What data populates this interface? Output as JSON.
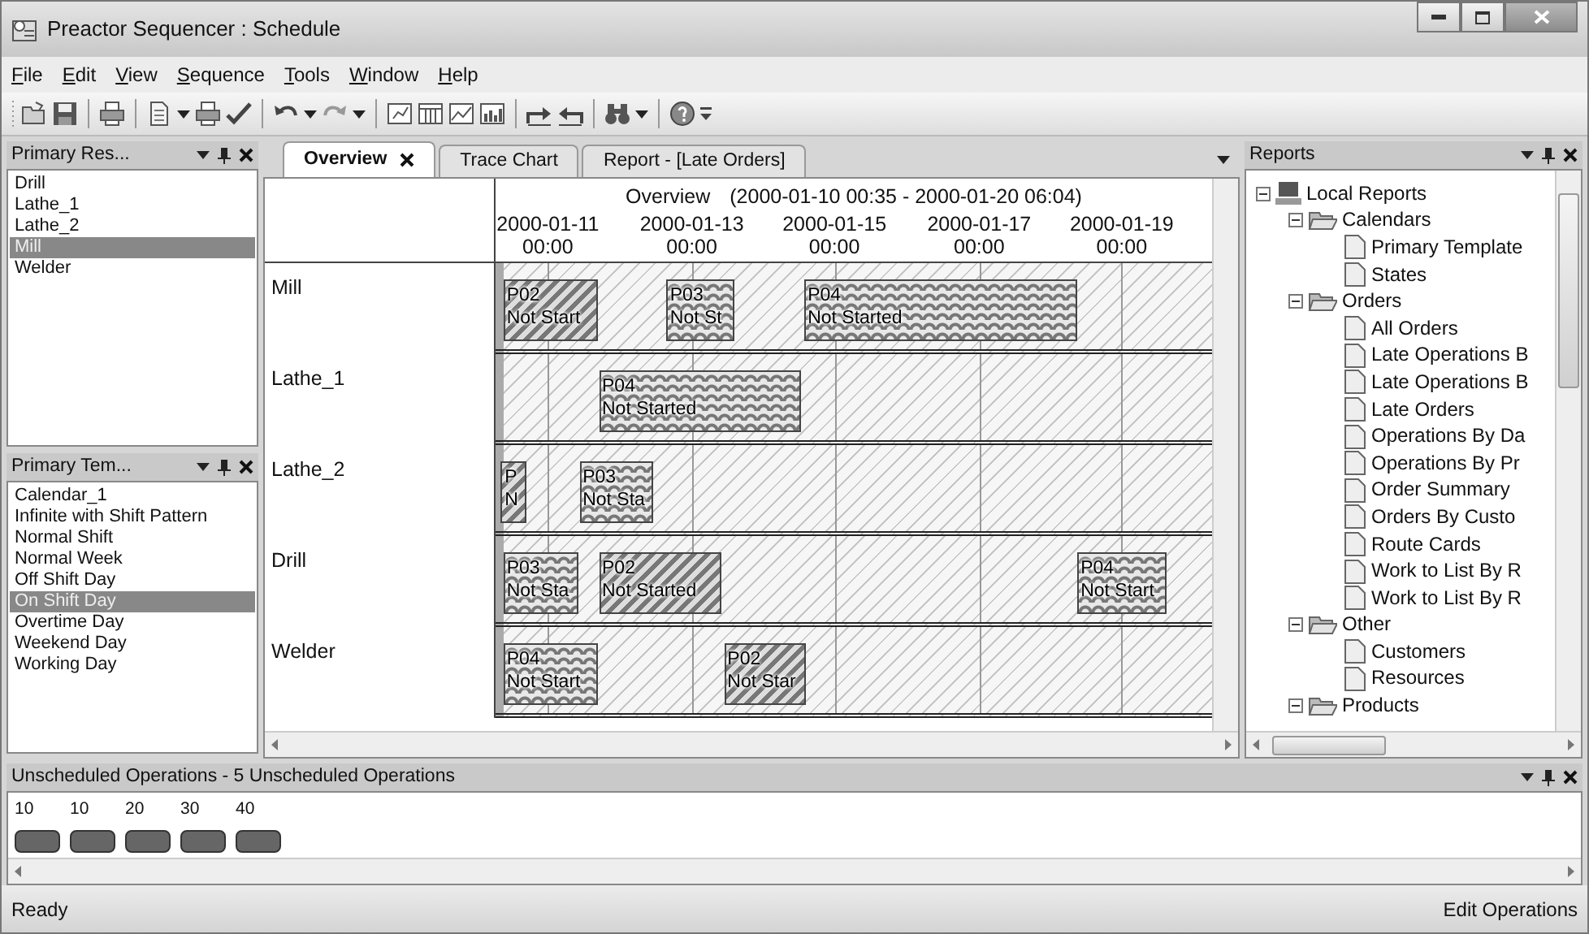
{
  "window": {
    "title": "Preactor Sequencer : Schedule"
  },
  "menu": [
    "File",
    "Edit",
    "View",
    "Sequence",
    "Tools",
    "Window",
    "Help"
  ],
  "left_panels": [
    {
      "title": "Primary Res...",
      "items": [
        {
          "label": "Drill",
          "selected": false
        },
        {
          "label": "Lathe_1",
          "selected": false
        },
        {
          "label": "Lathe_2",
          "selected": false
        },
        {
          "label": "Mill",
          "selected": true
        },
        {
          "label": "Welder",
          "selected": false
        }
      ]
    },
    {
      "title": "Primary Tem...",
      "items": [
        {
          "label": "Calendar_1",
          "selected": false
        },
        {
          "label": "Infinite with Shift Pattern",
          "selected": false
        },
        {
          "label": "Normal Shift",
          "selected": false
        },
        {
          "label": "Normal Week",
          "selected": false
        },
        {
          "label": "Off Shift Day",
          "selected": false
        },
        {
          "label": "On Shift Day",
          "selected": true
        },
        {
          "label": "Overtime Day",
          "selected": false
        },
        {
          "label": "Weekend Day",
          "selected": false
        },
        {
          "label": "Working Day",
          "selected": false
        }
      ]
    }
  ],
  "tabs": [
    {
      "label": "Overview",
      "selected": true,
      "closable": true
    },
    {
      "label": "Trace Chart",
      "selected": false,
      "closable": false
    },
    {
      "label": "Report - [Late Orders]",
      "selected": false,
      "closable": false
    }
  ],
  "gantt": {
    "title": "Overview",
    "range": "(2000-01-10 00:35 - 2000-01-20 06:04)",
    "ticks": [
      {
        "date": "2000-01-11",
        "time": "00:00"
      },
      {
        "date": "2000-01-13",
        "time": "00:00"
      },
      {
        "date": "2000-01-15",
        "time": "00:00"
      },
      {
        "date": "2000-01-17",
        "time": "00:00"
      },
      {
        "date": "2000-01-19",
        "time": "00:00"
      }
    ],
    "resources": [
      {
        "name": "Mill",
        "operations": [
          {
            "product": "P02",
            "status": "Not Start",
            "kind": "striped"
          },
          {
            "product": "P03",
            "status": "Not St",
            "kind": "wavy"
          },
          {
            "product": "P04",
            "status": "Not Started",
            "kind": "wavy"
          }
        ]
      },
      {
        "name": "Lathe_1",
        "operations": [
          {
            "product": "P04",
            "status": "Not Started",
            "kind": "wavy"
          }
        ]
      },
      {
        "name": "Lathe_2",
        "operations": [
          {
            "product": "P",
            "status": "N",
            "kind": "striped"
          },
          {
            "product": "P03",
            "status": "Not Sta",
            "kind": "wavy"
          }
        ]
      },
      {
        "name": "Drill",
        "operations": [
          {
            "product": "P03",
            "status": "Not Sta",
            "kind": "wavy"
          },
          {
            "product": "P02",
            "status": "Not Started",
            "kind": "striped"
          },
          {
            "product": "P04",
            "status": "Not Start",
            "kind": "wavy"
          }
        ]
      },
      {
        "name": "Welder",
        "operations": [
          {
            "product": "P04",
            "status": "Not Start",
            "kind": "wavy"
          },
          {
            "product": "P02",
            "status": "Not Star",
            "kind": "striped"
          }
        ]
      }
    ]
  },
  "reports": {
    "title": "Reports",
    "tree": [
      {
        "label": "Local Reports",
        "kind": "computer",
        "expanded": true,
        "children": [
          {
            "label": "Calendars",
            "kind": "folder",
            "expanded": true,
            "children": [
              {
                "label": "Primary Template",
                "kind": "report"
              },
              {
                "label": "States",
                "kind": "report"
              }
            ]
          },
          {
            "label": "Orders",
            "kind": "folder",
            "expanded": true,
            "children": [
              {
                "label": "All Orders",
                "kind": "report"
              },
              {
                "label": "Late Operations B",
                "kind": "report"
              },
              {
                "label": "Late Operations B",
                "kind": "report"
              },
              {
                "label": "Late Orders",
                "kind": "report"
              },
              {
                "label": "Operations By Da",
                "kind": "report"
              },
              {
                "label": "Operations By Pr",
                "kind": "report"
              },
              {
                "label": "Order Summary",
                "kind": "report"
              },
              {
                "label": "Orders By Custo",
                "kind": "report"
              },
              {
                "label": "Route Cards",
                "kind": "report"
              },
              {
                "label": "Work to List By R",
                "kind": "report"
              },
              {
                "label": "Work to List By R",
                "kind": "report"
              }
            ]
          },
          {
            "label": "Other",
            "kind": "folder",
            "expanded": true,
            "children": [
              {
                "label": "Customers",
                "kind": "report"
              },
              {
                "label": "Resources",
                "kind": "report"
              }
            ]
          },
          {
            "label": "Products",
            "kind": "folder",
            "expanded": true
          }
        ]
      }
    ]
  },
  "unscheduled": {
    "title": "Unscheduled Operations - 5 Unscheduled Operations",
    "operations": [
      {
        "label": "10"
      },
      {
        "label": "10"
      },
      {
        "label": "20"
      },
      {
        "label": "30"
      },
      {
        "label": "40"
      }
    ]
  },
  "status_bar": {
    "left": "Ready",
    "right": "Edit Operations"
  }
}
